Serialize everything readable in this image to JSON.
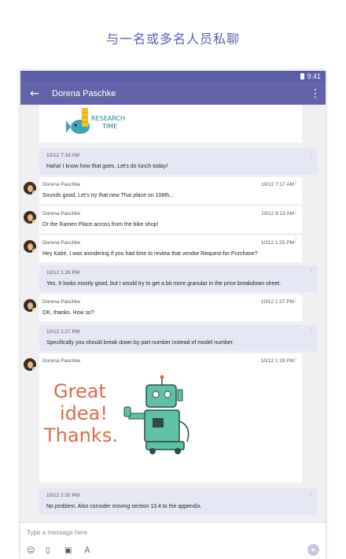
{
  "headline": "与一名或多名人员私聊",
  "status_bar": {
    "time": "9:41"
  },
  "app_bar": {
    "back_icon": "←",
    "title": "Dorena Paschke",
    "more_icon": "⋮"
  },
  "stickers": {
    "research": {
      "line1": "RESEARCH",
      "line2": "TIME"
    },
    "thanks": {
      "line1": "Great",
      "line2": "idea!",
      "line3": "Thanks."
    }
  },
  "messages": [
    {
      "mine": true,
      "time": "10/12 7:16 AM",
      "text": "Haha! I know how that goes. Let's do lunch today!"
    },
    {
      "mine": false,
      "sender": "Dorena Paschke",
      "time": "10/12 7:17 AM",
      "text": "Sounds good. Let's try that new Thai place on 108th..."
    },
    {
      "mine": false,
      "sender": "Dorena Paschke",
      "time": "10/12 8:13 AM",
      "text": "Or the Ramen Place across from the bike shop!"
    },
    {
      "mine": false,
      "sender": "Dorena Paschke",
      "time": "10/12 1:25 PM",
      "text": "Hey Katie, I was wondering if you had time to review that vendor Request-for-Purchase?"
    },
    {
      "mine": true,
      "time": "10/12 1:26 PM",
      "text": "Yes. It looks mostly good, but I would try to get a bit more granular in the price breakdown sheet."
    },
    {
      "mine": false,
      "sender": "Dorena Paschke",
      "time": "10/12 1:27 PM",
      "text": "OK, thanks. How so?"
    },
    {
      "mine": true,
      "time": "10/12 1:27 PM",
      "text": "Specifically you should break down by part number instead of model number."
    },
    {
      "mine": false,
      "sender": "Dorena Paschke",
      "time": "10/12 1:29 PM",
      "text": ""
    },
    {
      "mine": true,
      "time": "10/12 2:30 PM",
      "text": "No problem. Also consider moving section 13.4 to the appendix."
    }
  ],
  "composer": {
    "placeholder": "Type a message here",
    "tools": [
      "emoji-icon",
      "sticker-icon",
      "image-icon",
      "format-icon"
    ],
    "send_icon": "send-icon"
  },
  "colors": {
    "brand": "#6264a7",
    "status_bar": "#5c5fa6",
    "mine_bubble": "#e6e7f4",
    "presence": "#f3c21e"
  }
}
